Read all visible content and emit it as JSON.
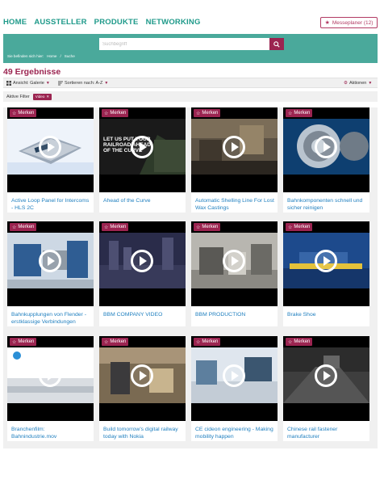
{
  "nav": {
    "items": [
      "HOME",
      "AUSSTELLER",
      "PRODUKTE",
      "NETWORKING"
    ],
    "planer_label": "Messeplaner (12)"
  },
  "search": {
    "placeholder": "Suchbegriff",
    "value": ""
  },
  "breadcrumb": {
    "prefix": "Sie befinden sich hier:",
    "home": "Home",
    "separator": "/",
    "current": "Suche"
  },
  "results": {
    "title": "49 Ergebnisse"
  },
  "toolbar": {
    "view_label": "Ansicht: Galerie",
    "sort_label": "Sortieren nach: A-Z",
    "actions_label": "Aktionen"
  },
  "filters": {
    "label": "Aktive Filter",
    "chips": [
      {
        "label": "Video"
      }
    ]
  },
  "card_common": {
    "merken_label": "Merken"
  },
  "cards": [
    {
      "title": "Active Loop Panel for Intercoms - HLS 2C",
      "overlay": ""
    },
    {
      "title": "Ahead of the Curve",
      "overlay": "LET US PUT YOUR RAILROAD AHEAD OF THE CURVE"
    },
    {
      "title": "Automatic Shelling Line For Lost Wax Castings",
      "overlay": ""
    },
    {
      "title": "Bahnkomponenten schnell und sicher reinigen",
      "overlay": ""
    },
    {
      "title": "Bahnkupplungen von Flender - erstklassige Verbindungen",
      "overlay": ""
    },
    {
      "title": "BBM COMPANY VIDEO",
      "overlay": ""
    },
    {
      "title": "BBM PRODUCTION",
      "overlay": ""
    },
    {
      "title": "Brake Shoe",
      "overlay": ""
    },
    {
      "title": "Branchenfilm: Bahnindustrie.mov",
      "overlay": ""
    },
    {
      "title": "Build tomorrow's digital railway today with Nokia",
      "overlay": ""
    },
    {
      "title": "CE cideon engineering - Making mobility happen",
      "overlay": ""
    },
    {
      "title": "Chinese rail fastener manufacturer",
      "overlay": ""
    }
  ],
  "colors": {
    "accent": "#9b2450",
    "teal": "#4aa99b",
    "nav_text": "#1f9a8a",
    "link": "#1f7fbf"
  }
}
